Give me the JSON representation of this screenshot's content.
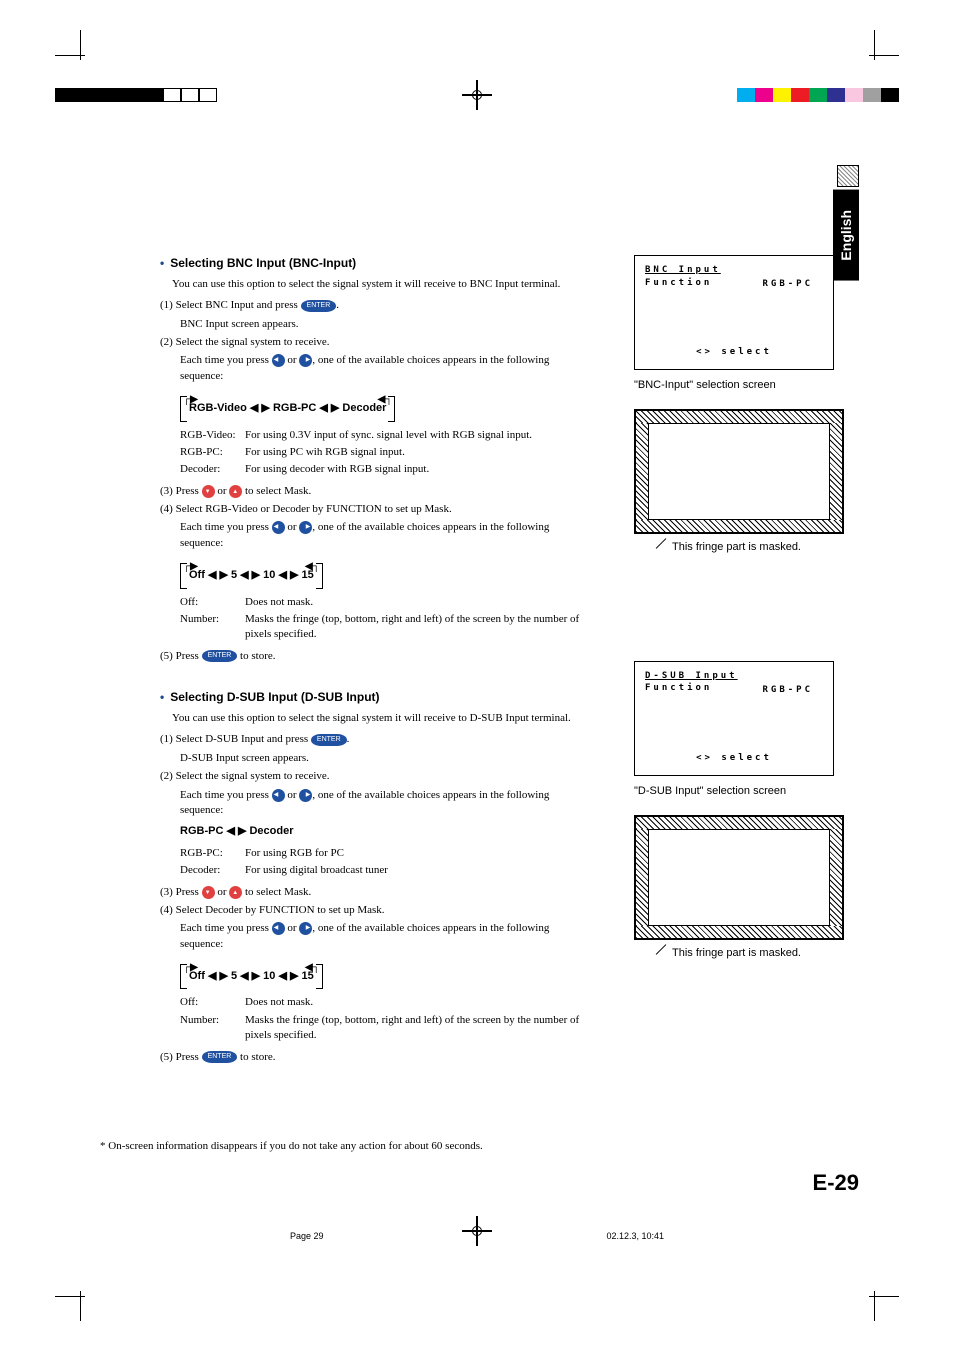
{
  "language_tab": "English",
  "colorbars": [
    "#00aeef",
    "#ec008c",
    "#fff200",
    "#ed1c24",
    "#00a651",
    "#2e3192",
    "#f9a8d4",
    "#a0a0a0",
    "#000000"
  ],
  "section1": {
    "title": "Selecting BNC Input (BNC-Input)",
    "intro": "You can use this option to select the signal system it will receive to BNC Input terminal.",
    "step1": "(1) Select BNC Input and press",
    "step1_sub": "BNC Input screen appears.",
    "step2": "(2) Select the signal system to receive.",
    "step2_sub_pre": "Each time you press ",
    "step2_sub_post": ", one of the available choices appears in the following sequence:",
    "cycle1": "RGB-Video ◀ ▶ RGB-PC ◀ ▶ Decoder",
    "defs": [
      {
        "label": "RGB-Video:",
        "value": "For using 0.3V input of sync. signal level with RGB signal input."
      },
      {
        "label": "RGB-PC:",
        "value": "For using PC wih RGB signal input."
      },
      {
        "label": "Decoder:",
        "value": "For using decoder with RGB signal input."
      }
    ],
    "step3_pre": "(3) Press ",
    "step3_post": " to select Mask.",
    "step4": "(4) Select RGB-Video or Decoder by FUNCTION to set up Mask.",
    "step4_sub_pre": "Each time you press ",
    "step4_sub_post": ", one of the available choices appears in the following sequence:",
    "cycle2": "Off ◀ ▶ 5 ◀ ▶ 10 ◀ ▶ 15",
    "defs2": [
      {
        "label": "Off:",
        "value": "Does not mask."
      },
      {
        "label": "Number:",
        "value": "Masks the fringe (top, bottom, right and left) of the screen by the number of pixels specified."
      }
    ],
    "step5_pre": "(5) Press ",
    "step5_post": " to store."
  },
  "section2": {
    "title": "Selecting D-SUB Input (D-SUB Input)",
    "intro": "You can use this option to select the signal system it will receive to D-SUB Input terminal.",
    "step1": "(1) Select D-SUB Input and press",
    "step1_sub": "D-SUB Input screen appears.",
    "step2": "(2) Select the signal system to receive.",
    "step2_sub_pre": "Each time you press ",
    "step2_sub_post": ", one of the available choices appears in the following sequence:",
    "cycle1": "RGB-PC ◀ ▶ Decoder",
    "defs": [
      {
        "label": "RGB-PC:",
        "value": "For using RGB for PC"
      },
      {
        "label": "Decoder:",
        "value": "For using digital broadcast tuner"
      }
    ],
    "step3_pre": "(3) Press ",
    "step3_post": " to select Mask.",
    "step4": "(4) Select Decoder by FUNCTION to set up Mask.",
    "step4_sub_pre": "Each time you press ",
    "step4_sub_post": ", one of the available choices appears in the following sequence:",
    "cycle2": "Off ◀ ▶ 5 ◀ ▶ 10 ◀ ▶ 15",
    "defs2": [
      {
        "label": "Off:",
        "value": "Does not mask."
      },
      {
        "label": "Number:",
        "value": "Masks the fringe (top, bottom, right and left) of the screen by the number of pixels specified."
      }
    ],
    "step5_pre": "(5) Press ",
    "step5_post": " to store."
  },
  "osd1": {
    "line1": "BNC Input",
    "line2": "Function",
    "value": "RGB-PC",
    "select": "<> select"
  },
  "caption1": "\"BNC-Input\" selection screen",
  "fringe_label": "This fringe part is masked.",
  "osd2": {
    "line1": "D-SUB Input",
    "line2": "Function",
    "value": "RGB-PC",
    "select": "<> select"
  },
  "caption2": "\"D-SUB Input\" selection screen",
  "footnote": "* On-screen information disappears if you do not take any action for about 60 seconds.",
  "page_num": "E-29",
  "footer_left": "Page 29",
  "footer_right": "02.12.3, 10:41",
  "enter_label": "ENTER",
  "or": " or "
}
